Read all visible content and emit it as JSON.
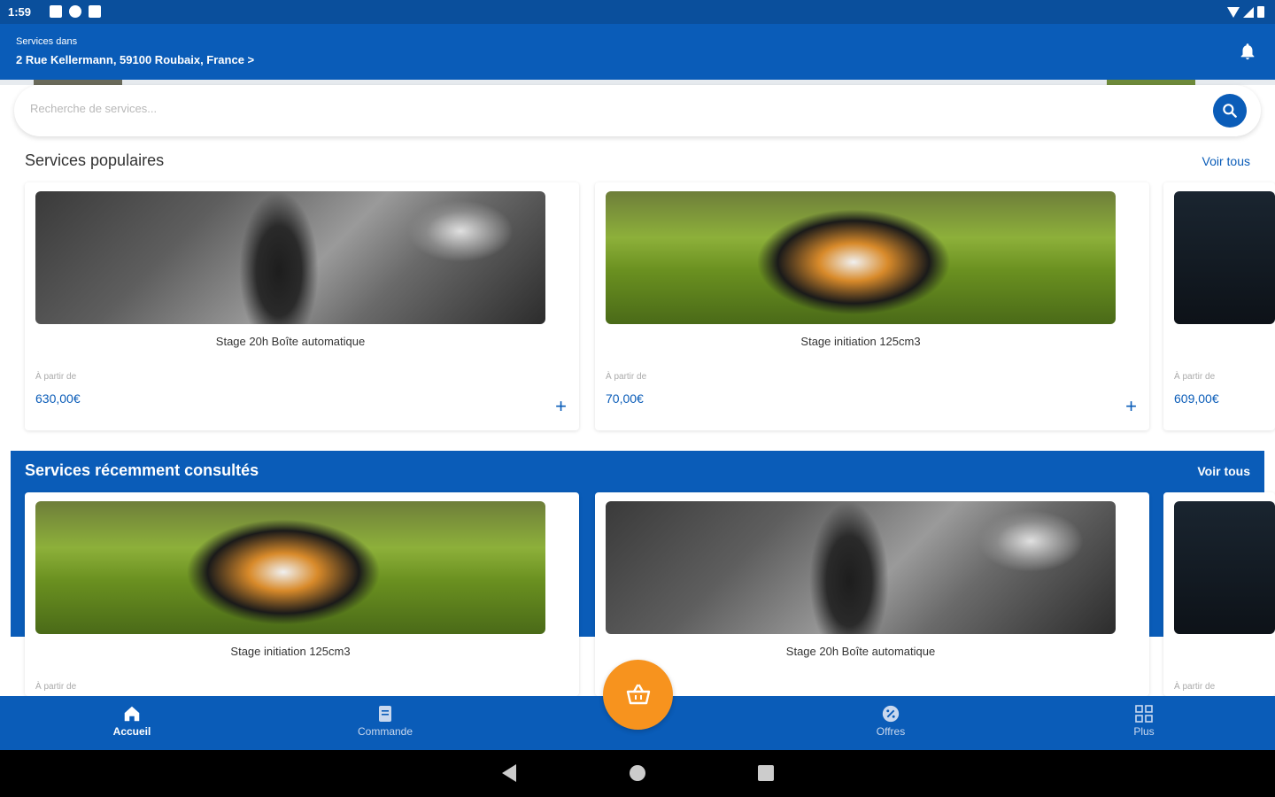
{
  "status_bar": {
    "time": "1:59"
  },
  "header": {
    "subtitle": "Services dans",
    "address": "2 Rue Kellermann, 59100 Roubaix, France >"
  },
  "search": {
    "placeholder": "Recherche de services..."
  },
  "popular": {
    "title": "Services populaires",
    "see_all": "Voir tous",
    "cards": [
      {
        "title": "Stage 20h Boîte automatique",
        "from_label": "À partir de",
        "price": "630,00€",
        "image": "car-gearshift"
      },
      {
        "title": "Stage initiation 125cm3",
        "from_label": "À partir de",
        "price": "70,00€",
        "image": "motorbike"
      },
      {
        "title": "",
        "from_label": "À partir de",
        "price": "609,00€",
        "image": "car-interior-dark"
      }
    ]
  },
  "recent": {
    "title": "Services récemment consultés",
    "see_all": "Voir tous",
    "cards": [
      {
        "title": "Stage initiation 125cm3",
        "from_label": "À partir de",
        "image": "motorbike"
      },
      {
        "title": "Stage 20h Boîte automatique",
        "from_label": "",
        "image": "car-gearshift"
      },
      {
        "title": "",
        "from_label": "À partir de",
        "image": "car-interior-dark"
      }
    ]
  },
  "bottom_nav": {
    "items": [
      {
        "label": "Accueil",
        "icon": "home-icon",
        "active": true
      },
      {
        "label": "Commande",
        "icon": "receipt-icon",
        "active": false
      },
      {
        "label": "Offres",
        "icon": "offer-icon",
        "active": false
      },
      {
        "label": "Plus",
        "icon": "grid-icon",
        "active": false
      }
    ],
    "fab_icon": "basket-icon"
  },
  "colors": {
    "primary": "#0a5cb8",
    "accent": "#f7931e",
    "status_bar": "#0a4f9c"
  }
}
